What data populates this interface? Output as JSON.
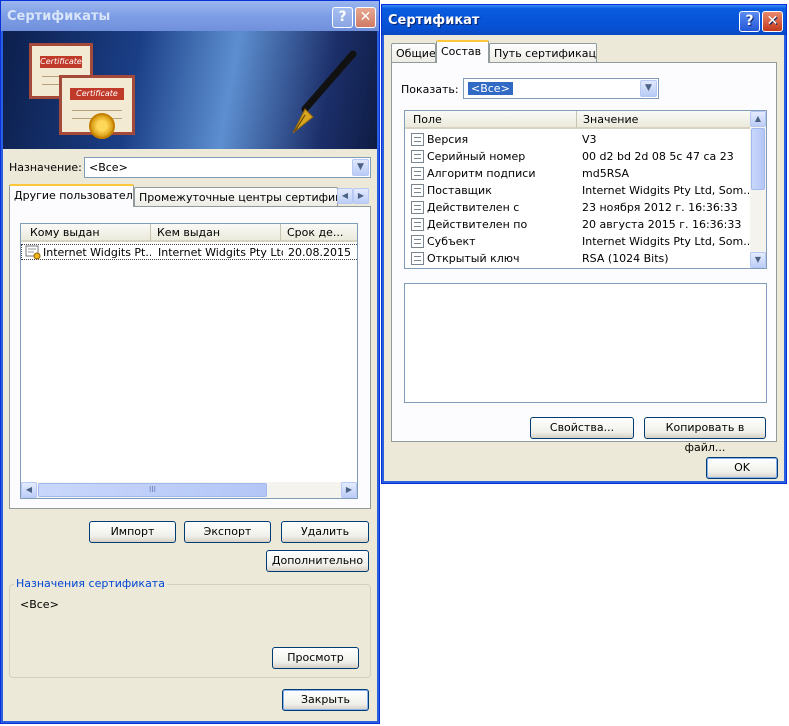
{
  "win1": {
    "title": "Сертификаты",
    "banner": {
      "cert_word_1": "Certificate",
      "cert_word_2": "Certificate"
    },
    "purpose_label": "Назначение:",
    "purpose_value": "<Все>",
    "tabs": [
      {
        "label": "Другие пользователи"
      },
      {
        "label": "Промежуточные центры сертификации"
      }
    ],
    "columns": [
      "Кому выдан",
      "Кем выдан",
      "Срок де..."
    ],
    "rows": [
      {
        "issued_to": "Internet Widgits Pt...",
        "issued_by": "Internet Widgits Pty Ltd",
        "expires": "20.08.2015"
      }
    ],
    "hscroll_grip": "III",
    "buttons": {
      "import": "Импорт",
      "export": "Экспорт",
      "delete": "Удалить",
      "advanced": "Дополнительно",
      "view": "Просмотр",
      "close": "Закрыть"
    },
    "group_title": "Назначения сертификата",
    "group_value": "<Все>"
  },
  "win2": {
    "title": "Сертификат",
    "tabs": [
      {
        "label": "Общие"
      },
      {
        "label": "Состав"
      },
      {
        "label": "Путь сертификации"
      }
    ],
    "show_label": "Показать:",
    "show_value": "<Все>",
    "columns": [
      "Поле",
      "Значение"
    ],
    "fields": [
      {
        "name": "Версия",
        "value": "V3"
      },
      {
        "name": "Серийный номер",
        "value": "00 d2 bd 2d 08 5c 47 ca 23"
      },
      {
        "name": "Алгоритм подписи",
        "value": "md5RSA"
      },
      {
        "name": "Поставщик",
        "value": "Internet Widgits Pty Ltd, Som..."
      },
      {
        "name": "Действителен с",
        "value": "23 ноября 2012 г. 16:36:33"
      },
      {
        "name": "Действителен по",
        "value": "20 августа 2015 г. 16:36:33"
      },
      {
        "name": "Субъект",
        "value": "Internet Widgits Pty Ltd, Som..."
      },
      {
        "name": "Открытый ключ",
        "value": "RSA (1024 Bits)"
      }
    ],
    "buttons": {
      "properties": "Свойства...",
      "copy_to_file": "Копировать в файл...",
      "ok": "OK"
    }
  },
  "titlebar_buttons": {
    "help": "?",
    "close": "✕"
  },
  "colors": {
    "titlebar_active": "#0754d8",
    "selection": "#316ac5",
    "dialog_bg": "#ece9d8"
  }
}
